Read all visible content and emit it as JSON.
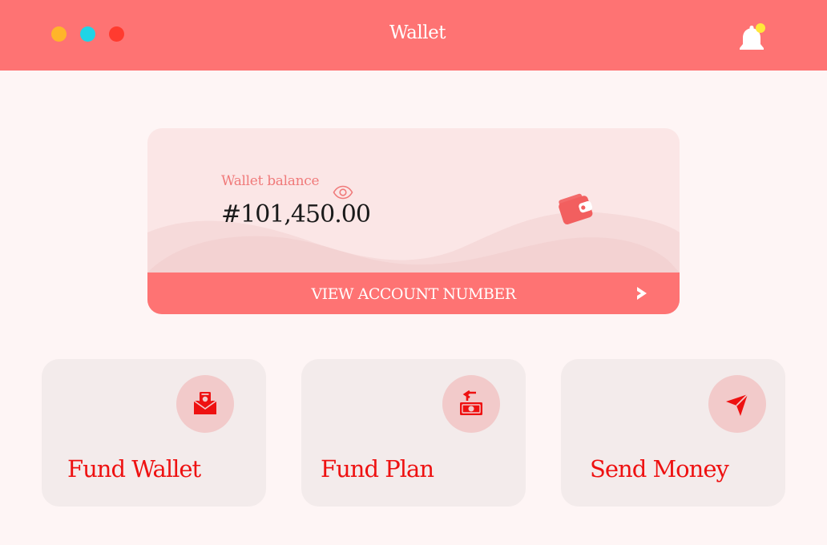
{
  "header": {
    "title": "Wallet",
    "window_controls": [
      "minimize-dot",
      "maximize-dot",
      "close-dot"
    ],
    "notification_icon": "bell-icon",
    "has_unread_notification": true
  },
  "balance_card": {
    "label": "Wallet balance",
    "amount": "#101,450.00",
    "visibility_icon": "eye-icon",
    "wallet_icon": "wallet-icon",
    "action_label": "VIEW ACCOUNT NUMBER",
    "action_icon": "chevron-right-icon"
  },
  "actions": [
    {
      "label": "Fund Wallet",
      "icon": "money-envelope-icon"
    },
    {
      "label": "Fund Plan",
      "icon": "money-return-icon"
    },
    {
      "label": "Send Money",
      "icon": "send-arrow-icon"
    }
  ],
  "colors": {
    "header_bg": "#fe7373",
    "page_bg": "#fef5f5",
    "card_bg": "#fbe6e6",
    "tile_bg": "#f3ebeb",
    "icon_circle_bg": "#f2caca",
    "accent_red": "#ee1111",
    "label_pink": "#f07a7a",
    "dot_yellow": "#ffb52a",
    "dot_cyan": "#1fd4e6",
    "dot_red": "#ff3b2f",
    "badge_yellow": "#ffe83a"
  }
}
